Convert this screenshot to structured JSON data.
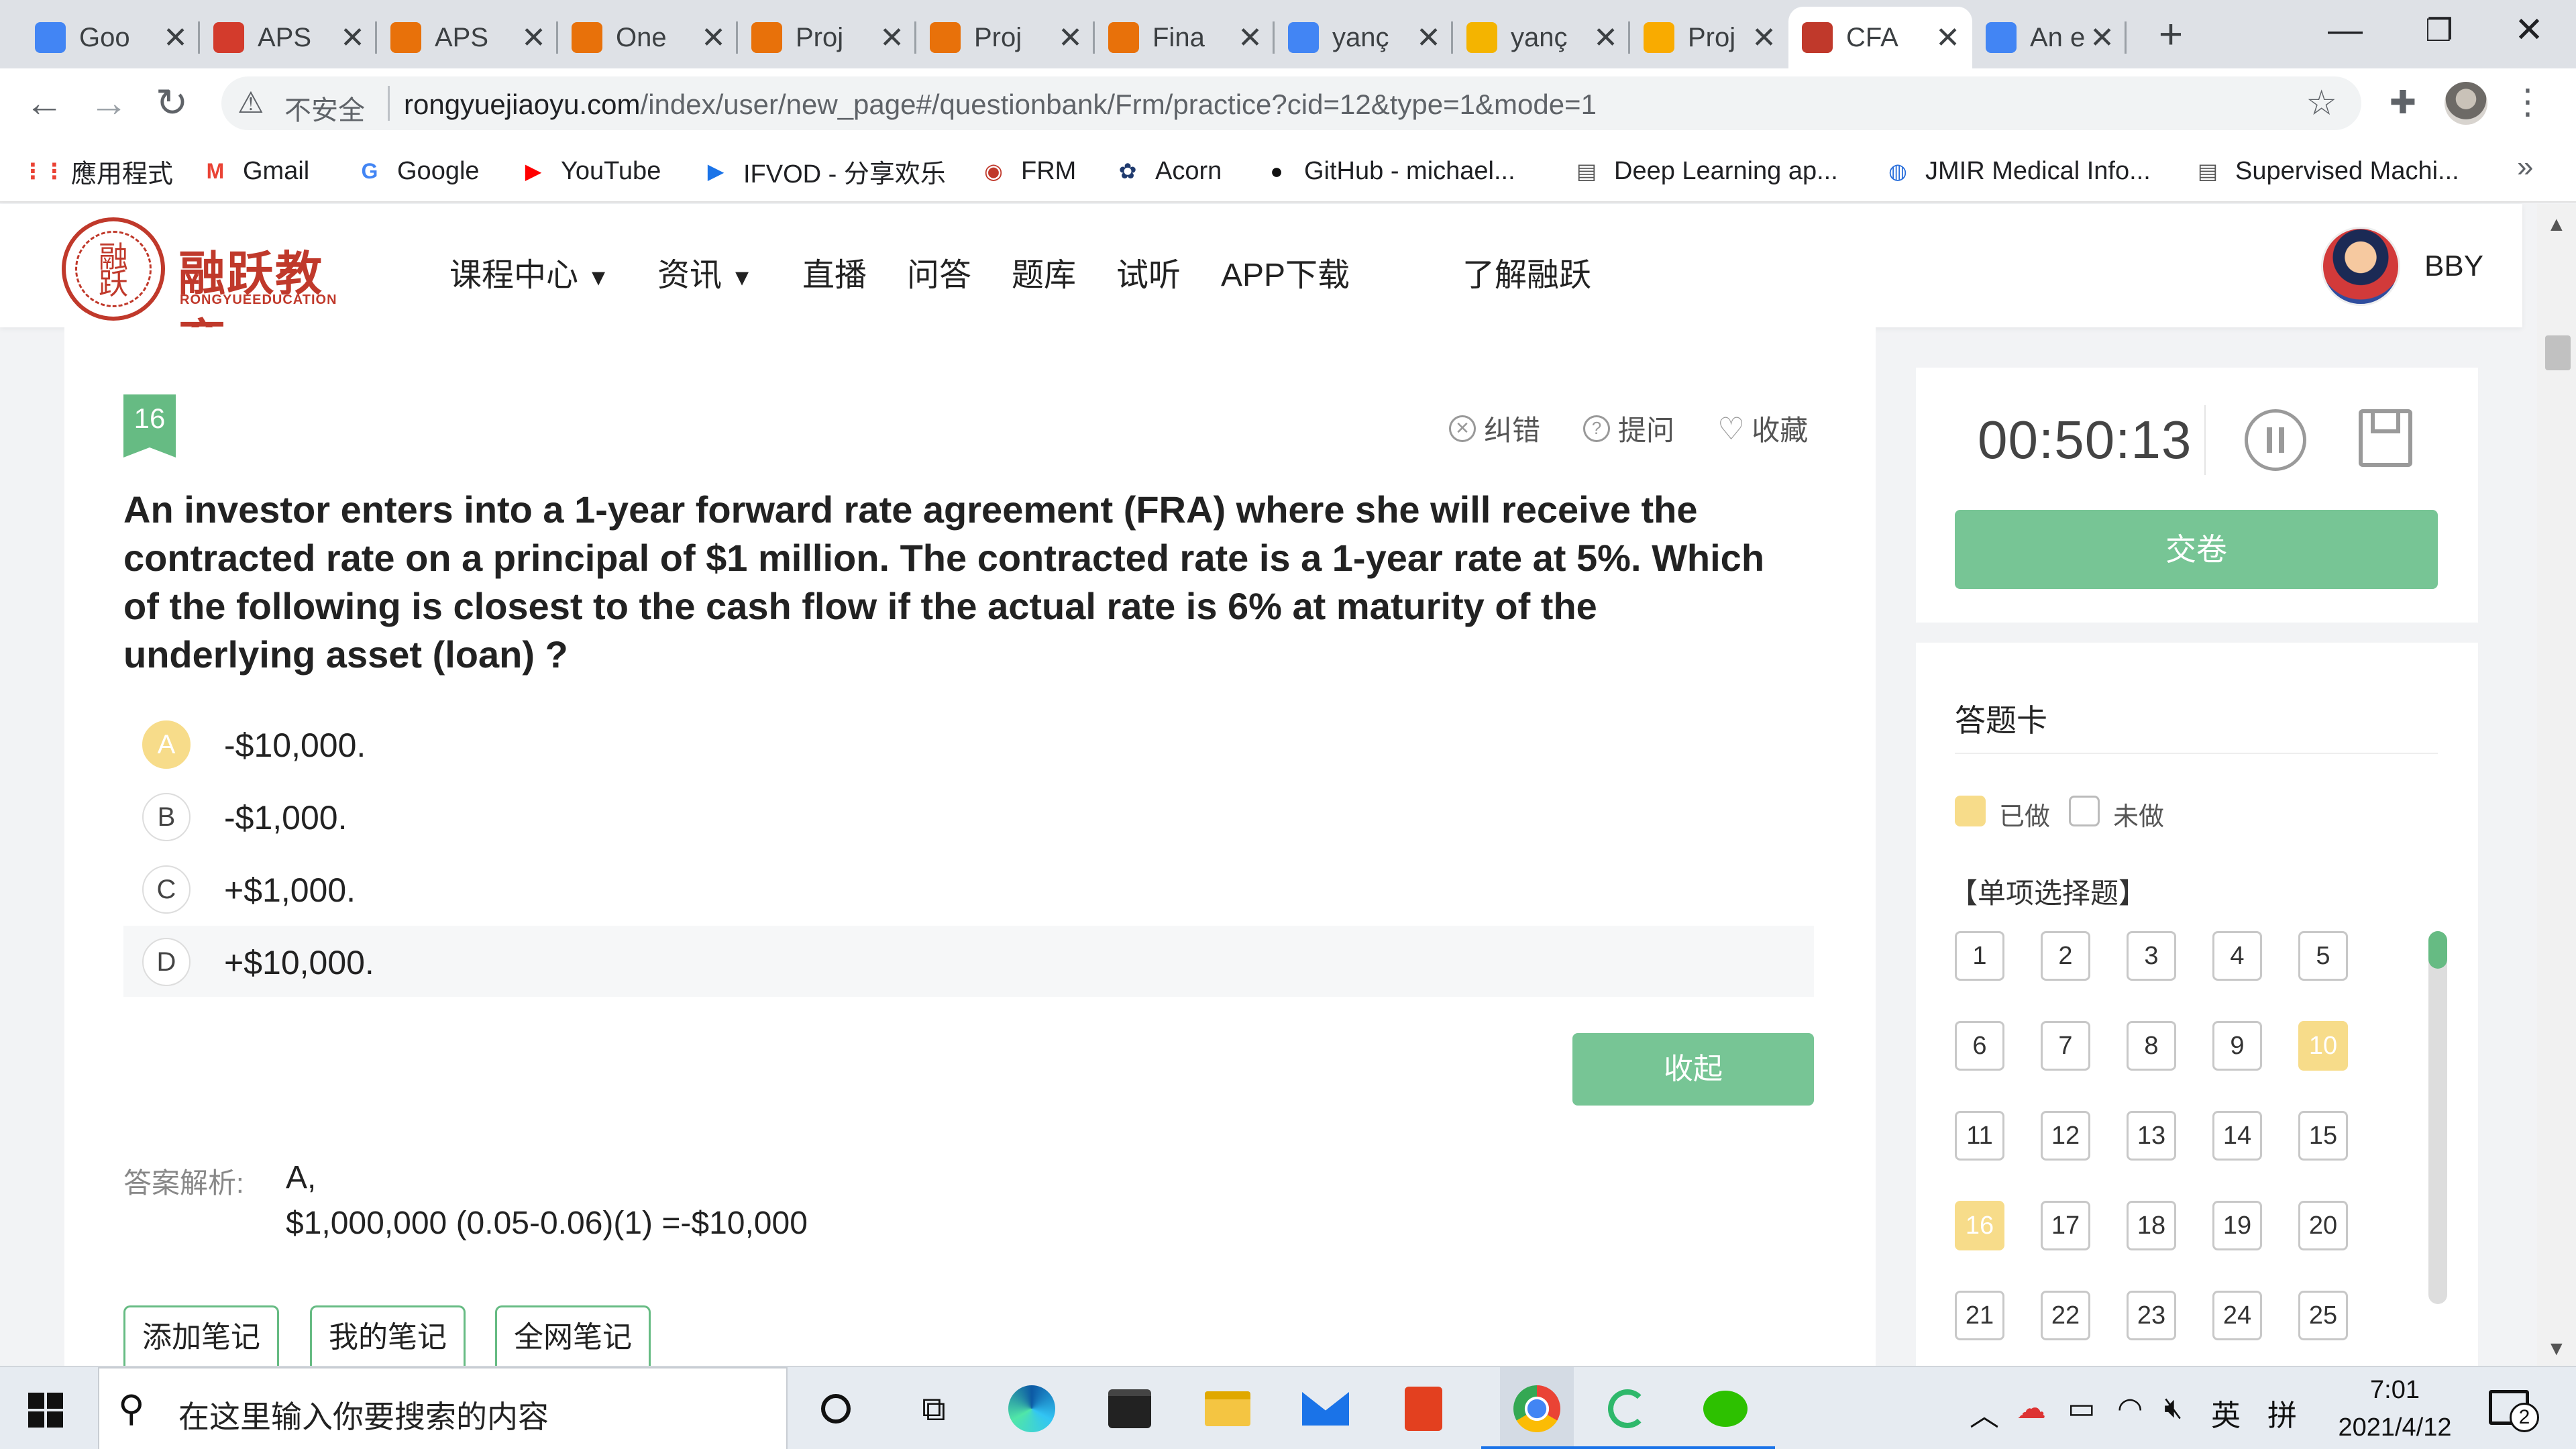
{
  "browser": {
    "tabs": [
      {
        "title": "Goo",
        "favicon": "google-docs-icon",
        "color": "#4285f4"
      },
      {
        "title": "APS",
        "favicon": "aps-icon",
        "color": "#d33b2c"
      },
      {
        "title": "APS",
        "favicon": "book-icon",
        "color": "#e8710a"
      },
      {
        "title": "One",
        "favicon": "loading-icon",
        "color": "#e8710a"
      },
      {
        "title": "Proj",
        "favicon": "book-icon",
        "color": "#e8710a"
      },
      {
        "title": "Proj",
        "favicon": "book-icon",
        "color": "#e8710a"
      },
      {
        "title": "Fina",
        "favicon": "book-icon",
        "color": "#e8710a"
      },
      {
        "title": "yanç",
        "favicon": "google-docs-icon",
        "color": "#4285f4"
      },
      {
        "title": "yanç",
        "favicon": "google-slides-icon",
        "color": "#f4b400"
      },
      {
        "title": "Proj",
        "favicon": "colab-icon",
        "color": "#f9ab00"
      },
      {
        "title": "CFA",
        "favicon": "rongyue-icon",
        "color": "#c0392b"
      },
      {
        "title": "An e",
        "favicon": "google-icon",
        "color": "#4285f4"
      }
    ],
    "new_tab_symbol": "+",
    "minimize_symbol": "—",
    "restore_symbol": "❐",
    "close_symbol": "✕",
    "security_label": "不安全",
    "url_domain": "rongyuejiaoyu.com",
    "url_path": "/index/user/new_page#/questionbank/Frm/practice?cid=12&type=1&mode=1",
    "bookmarks": [
      {
        "label": "應用程式",
        "icon": "apps-grid-icon",
        "color": "#ea4335"
      },
      {
        "label": "Gmail",
        "icon": "gmail-icon",
        "color": "#ea4335"
      },
      {
        "label": "Google",
        "icon": "google-icon",
        "color": "#4285f4"
      },
      {
        "label": "YouTube",
        "icon": "youtube-icon",
        "color": "#ff0000"
      },
      {
        "label": "IFVOD - 分享欢乐",
        "icon": "ifvod-icon",
        "color": "#1a73e8"
      },
      {
        "label": "FRM",
        "icon": "rongyue-icon",
        "color": "#c0392b"
      },
      {
        "label": "Acorn",
        "icon": "acorn-icon",
        "color": "#1f3a6e"
      },
      {
        "label": "GitHub - michael...",
        "icon": "github-icon",
        "color": "#111111"
      },
      {
        "label": "Deep Learning ap...",
        "icon": "page-icon",
        "color": "#555555"
      },
      {
        "label": "JMIR Medical Info...",
        "icon": "jmir-icon",
        "color": "#2a6fdb"
      },
      {
        "label": "Supervised Machi...",
        "icon": "page-icon",
        "color": "#555555"
      }
    ],
    "more_symbol": "»"
  },
  "site": {
    "logo_cn": "融跃教育",
    "logo_en": "RONGYUEEDUCATION",
    "logo_seal": "融跃",
    "nav": [
      {
        "label": "课程中心",
        "dropdown": true
      },
      {
        "label": "资讯",
        "dropdown": true
      },
      {
        "label": "直播"
      },
      {
        "label": "问答"
      },
      {
        "label": "题库"
      },
      {
        "label": "试听"
      },
      {
        "label": "APP下载"
      },
      {
        "label": "了解融跃"
      }
    ],
    "username": "BBY"
  },
  "question": {
    "number": "16",
    "actions": {
      "report": "纠错",
      "ask": "提问",
      "favorite": "收藏"
    },
    "text": "An investor enters into a 1-year forward rate agreement (FRA) where she will receive the contracted rate on a principal of $1 million. The contracted rate is a 1-year rate at 5%. Which of the following is closest to the cash flow if the actual rate is 6% at maturity of the underlying asset (loan) ?",
    "options": [
      {
        "letter": "A",
        "text": "-$10,000.",
        "selected": true
      },
      {
        "letter": "B",
        "text": "-$1,000."
      },
      {
        "letter": "C",
        "text": "+$1,000."
      },
      {
        "letter": "D",
        "text": "+$10,000.",
        "hovered": true
      }
    ],
    "collapse_label": "收起",
    "analysis_label": "答案解析:",
    "analysis_answer": "A,",
    "analysis_detail": "$1,000,000 (0.05-0.06)(1) =-$10,000",
    "note_buttons": [
      "添加笔记",
      "我的笔记",
      "全网笔记"
    ]
  },
  "timer": {
    "value": "00:50:13",
    "submit_label": "交卷"
  },
  "answer_sheet": {
    "title": "答题卡",
    "legend_done": "已做",
    "legend_undone": "未做",
    "section": "【单项选择题】",
    "numbers": [
      "1",
      "2",
      "3",
      "4",
      "5",
      "6",
      "7",
      "8",
      "9",
      "10",
      "11",
      "12",
      "13",
      "14",
      "15",
      "16",
      "17",
      "18",
      "19",
      "20",
      "21",
      "22",
      "23",
      "24",
      "25"
    ],
    "done": [
      "10",
      "16"
    ],
    "accent_color": "#f7dc8a"
  },
  "taskbar": {
    "search_placeholder": "在这里输入你要搜索的内容",
    "lang_en": "英",
    "lang_pinyin": "拼",
    "time": "7:01",
    "date": "2021/4/12",
    "notification_count": "2"
  },
  "colors": {
    "brand_red": "#c0392b",
    "green": "#77c595",
    "tab_bg": "#dee1e6"
  }
}
